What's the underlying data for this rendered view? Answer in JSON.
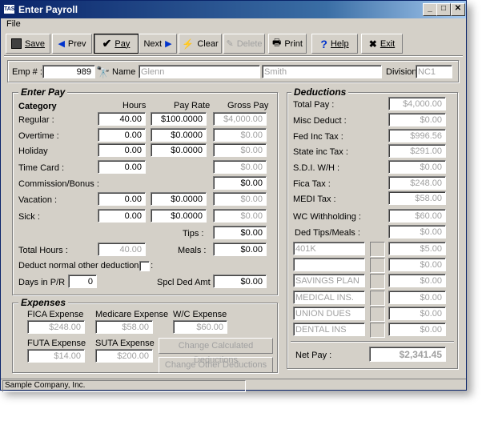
{
  "window": {
    "title": "Enter Payroll",
    "app_badge": "TAS"
  },
  "menu": {
    "file": "File"
  },
  "toolbar": {
    "save": "Save",
    "prev": "Prev",
    "pay": "Pay",
    "next": "Next",
    "clear": "Clear",
    "delete": "Delete",
    "print": "Print",
    "help": "Help",
    "exit": "Exit"
  },
  "employee": {
    "emp_label": "Emp # :",
    "emp_no": "989",
    "name_label": "Name :",
    "first": "Glenn",
    "last": "Smith",
    "division_label": "Division:",
    "division": "NC1"
  },
  "enter_pay": {
    "title": "Enter Pay",
    "headers": {
      "category": "Category",
      "hours": "Hours",
      "rate": "Pay Rate",
      "gross": "Gross Pay"
    },
    "rows": [
      {
        "label": "Regular :",
        "hours": "40.00",
        "rate": "$100.0000",
        "gross": "$4,000.00"
      },
      {
        "label": "Overtime :",
        "hours": "0.00",
        "rate": "$0.0000",
        "gross": "$0.00"
      },
      {
        "label": "Holiday",
        "hours": "0.00",
        "rate": "$0.0000",
        "gross": "$0.00"
      },
      {
        "label": "Time Card :",
        "hours": "0.00",
        "gross": "$0.00"
      },
      {
        "label": "Commission/Bonus :",
        "gross": "$0.00"
      },
      {
        "label": "Vacation :",
        "hours": "0.00",
        "rate": "$0.0000",
        "gross": "$0.00"
      },
      {
        "label": "Sick :",
        "hours": "0.00",
        "rate": "$0.0000",
        "gross": "$0.00"
      }
    ],
    "tips_label": "Tips :",
    "tips": "$0.00",
    "total_hours_label": "Total Hours :",
    "total_hours": "40.00",
    "meals_label": "Meals :",
    "meals": "$0.00",
    "deduct_label": "Deduct normal other deductions? :",
    "days_label": "Days in P/R :",
    "days": "0",
    "spcl_label": "Spcl Ded Amt :",
    "spcl": "$0.00"
  },
  "expenses": {
    "title": "Expenses",
    "fica_label": "FICA Expense",
    "fica": "$248.00",
    "medicare_label": "Medicare Expense",
    "medicare": "$58.00",
    "wc_label": "W/C Expense",
    "wc": "$60.00",
    "futa_label": "FUTA Expense",
    "futa": "$14.00",
    "suta_label": "SUTA Expense",
    "suta": "$200.00",
    "btn_calc": "Change Calculated Deductions",
    "btn_other": "Change Other Deductions"
  },
  "deductions": {
    "title": "Deductions",
    "rows": [
      {
        "label": "Total Pay :",
        "value": "$4,000.00"
      },
      {
        "label": "Misc Deduct :",
        "value": "$0.00"
      },
      {
        "label": "Fed Inc Tax :",
        "value": "$996.56"
      },
      {
        "label": "State inc Tax :",
        "value": "$291.00"
      },
      {
        "label": "S.D.I. W/H :",
        "value": "$0.00"
      },
      {
        "label": "Fica Tax :",
        "value": "$248.00"
      },
      {
        "label": "MEDI Tax :",
        "value": "$58.00"
      },
      {
        "label": "WC Withholding :",
        "value": "$60.00"
      },
      {
        "label": "Ded Tips/Meals :",
        "value": "$0.00"
      }
    ],
    "other": [
      {
        "name": "401K",
        "value": "$5.00"
      },
      {
        "name": "",
        "value": "$0.00"
      },
      {
        "name": "SAVINGS PLAN",
        "value": "$0.00"
      },
      {
        "name": "MEDICAL INS.",
        "value": "$0.00"
      },
      {
        "name": "UNION DUES",
        "value": "$0.00"
      },
      {
        "name": "DENTAL INS",
        "value": "$0.00"
      }
    ],
    "net_label": "Net Pay :",
    "net": "$2,341.45"
  },
  "status": {
    "company": "Sample Company, Inc."
  }
}
